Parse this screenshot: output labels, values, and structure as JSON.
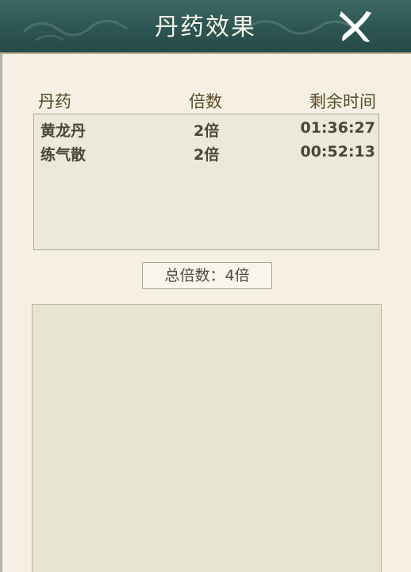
{
  "header": {
    "title": "丹药效果",
    "close_icon": "close-icon"
  },
  "table": {
    "columns": {
      "name": "丹药",
      "multiplier": "倍数",
      "remaining_time": "剩余时间"
    },
    "rows": [
      {
        "name": "黄龙丹",
        "multiplier": "2倍",
        "remaining_time": "01:36:27"
      },
      {
        "name": "练气散",
        "multiplier": "2倍",
        "remaining_time": "00:52:13"
      }
    ]
  },
  "total": {
    "label": "总倍数：",
    "value": "4倍"
  },
  "colors": {
    "header_bg": "#2d5552",
    "panel_bg": "#f5f0e3",
    "list_bg": "#ebe8dc",
    "detail_bg": "#e6e5d0",
    "header_text": "#f7f4e8",
    "column_text": "#5b4a28"
  }
}
